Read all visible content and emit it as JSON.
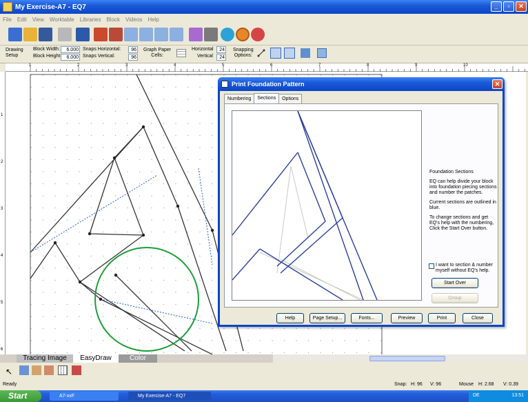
{
  "window": {
    "title": "My Exercise-A7 - EQ7"
  },
  "menu": [
    "File",
    "Edit",
    "View",
    "Worktable",
    "Libraries",
    "Block",
    "Videos",
    "Help"
  ],
  "toolbar2": {
    "drawing_setup": "Drawing\nSetup",
    "block_width_label": "Block Width:",
    "block_width": "6.000",
    "block_height_label": "Block Height:",
    "block_height": "6.000",
    "snaps_h_label": "Snaps Horizontal:",
    "snaps_h": "96",
    "snaps_v_label": "Snaps Vertical:",
    "snaps_v": "96",
    "graph_label": "Graph Paper\nCells:",
    "horizontal_label": "Horizontal",
    "horizontal": "24",
    "vertical_label": "Vertical",
    "vertical": "24",
    "snapping_label": "Snapping\nOptions:"
  },
  "ruler_numbers": [
    "1",
    "2",
    "3",
    "4",
    "5",
    "6",
    "7",
    "8",
    "9",
    "10"
  ],
  "vruler_numbers": [
    "1",
    "2",
    "3",
    "4",
    "5",
    "6"
  ],
  "bottom_tabs": [
    "Tracing Image",
    "EasyDraw",
    "Color"
  ],
  "status": {
    "left": "Ready",
    "snap": "Snap:",
    "snap_h": "H: 96",
    "snap_v": "V: 96",
    "mouse": "Mouse",
    "mouse_h": "H: 2.68",
    "mouse_v": "V: 0.39"
  },
  "taskbar": {
    "start": "Start",
    "tasks": [
      "A7-xxF",
      "My Exercise-A7 - EQ7"
    ],
    "lang": "DE",
    "clock": "13:51"
  },
  "dialog": {
    "title": "Print Foundation Pattern",
    "tabs": [
      "Numbering",
      "Sections",
      "Options"
    ],
    "active_tab": "Sections",
    "info_heading": "Foundation Sections",
    "info_p1": "EQ can help divide your block into foundation piecing sections and number the patches.",
    "info_p2": "Current sections are outlined in blue.",
    "info_p3": "To change sections and get EQ's help with the numbering, Click the Start Over button.",
    "checkbox_label": "I want to section & number myself without EQ's help.",
    "start_over": "Start Over",
    "group": "Group",
    "buttons": [
      "Help",
      "Page Setup...",
      "Fonts...",
      "Preview",
      "Print",
      "Close"
    ]
  },
  "colors": {
    "accent": "#0a46c8",
    "highlight_circle": "#1a9e3a",
    "section_blue": "#2a3fa0"
  }
}
